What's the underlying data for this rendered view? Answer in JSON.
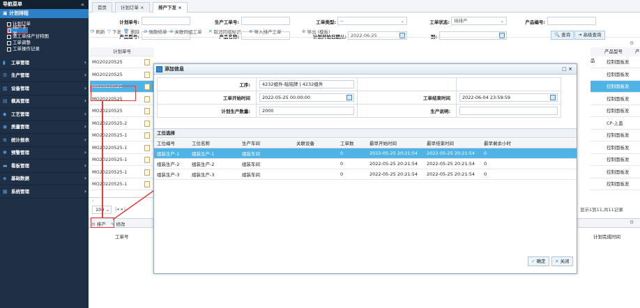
{
  "sidebar": {
    "title": "导航菜单",
    "collapse": "«",
    "active": "计划排程",
    "sub": [
      "计划订单",
      "排产下发",
      "派工单排产甘特图",
      "工单调整",
      "工单操作记录"
    ],
    "menus": [
      {
        "icon": "▮",
        "label": "工单管理"
      },
      {
        "icon": "⚙",
        "label": "生产管理"
      },
      {
        "icon": "▥",
        "label": "设备管理"
      },
      {
        "icon": "▤",
        "label": "模具管理"
      },
      {
        "icon": "◆",
        "label": "工艺管理"
      },
      {
        "icon": "◉",
        "label": "质量管理"
      },
      {
        "icon": "≋",
        "label": "统计报表"
      },
      {
        "icon": "✱",
        "label": "预警管理"
      },
      {
        "icon": "▬",
        "label": "看板管理"
      },
      {
        "icon": "◈",
        "label": "基础数据"
      },
      {
        "icon": "▦",
        "label": "系统管理"
      }
    ]
  },
  "tabs": {
    "home": "首页",
    "plan": "计划订单 ×",
    "dispatch": "排产下发 ×"
  },
  "filters": {
    "plan_no": "计划单号:",
    "order_no": "生产工单号:",
    "order_type": "工单类型:",
    "order_type_val": "--",
    "order_status": "工单状态:",
    "order_status_val": "待排产",
    "product_no": "产品编号:",
    "product_model": "产品型号:",
    "product_name": "产品名称:",
    "plan_start": "计划开始日期从:",
    "plan_start_val": "2022-06-25",
    "to": "到:",
    "search": "查询",
    "adv_search": "高级查询"
  },
  "toolbar": [
    "刷新",
    "下发",
    "删除",
    "强制结单",
    "关联同组工单",
    "取消同组标识",
    "导入排产工单",
    "导出 (模板)"
  ],
  "grid": {
    "header": "计划单号",
    "rows": [
      "MO20220525",
      "MO20220525",
      "MO20220525",
      "MO20220525",
      "MO20220525",
      "MO20220525-2",
      "MO20220525-1",
      "MO20220525-1",
      "MO20220525-1",
      "MO20220525-1",
      "MO20220525-1"
    ],
    "right_header1": "产品型号",
    "right_header2": "产品",
    "right_vals": [
      "控制面板发",
      "控制面板发",
      "控制面板发",
      "控制面板发",
      "控制面板发",
      "CP-上盖",
      "控制面板发",
      "控制面板发",
      "控制面板发",
      "控制面板发",
      "控制面板发"
    ],
    "page_size": "100",
    "page_info": "显示1到11,共11记录"
  },
  "bottom": {
    "schedule": "排产",
    "edit": "修改",
    "col_order": "工单号",
    "col_finish": "计划完成时间"
  },
  "dialog": {
    "title": "添加信息",
    "ctl": "□ ×",
    "proc_label": "工序:",
    "proc_val": "4232组件-贴铭牌 | 4232组件",
    "start_label": "工单开始时间",
    "start_val": "2022-05-25 00:00:00",
    "end_label": "工单结束时间",
    "end_val": "2022-06-04 23:59:59",
    "qty_label": "计划生产数量:",
    "qty_val": "2000",
    "note_label": "生产说明:",
    "section": "工位选择",
    "cols": [
      "工位编号",
      "工位名称",
      "生产车间",
      "关联设备",
      "工单数",
      "最早开始时间",
      "最早结束时间",
      "最早剩余小时"
    ],
    "rows": [
      [
        "组装生产-1",
        "组装生产-1",
        "组装车间",
        "",
        "0",
        "2022-05-25 20:21:54",
        "2022-05-25 20:21:54",
        "0"
      ],
      [
        "组装生产-2",
        "组装生产-2",
        "组装车间",
        "",
        "0",
        "2022-05-25 20:21:54",
        "2022-05-25 20:21:54",
        "0"
      ],
      [
        "组装生产-3",
        "组装生产-3",
        "组装车间",
        "",
        "0",
        "2022-05-25 20:21:54",
        "2022-05-25 20:21:54",
        "0"
      ]
    ],
    "ok": "确定",
    "close": "关闭"
  }
}
